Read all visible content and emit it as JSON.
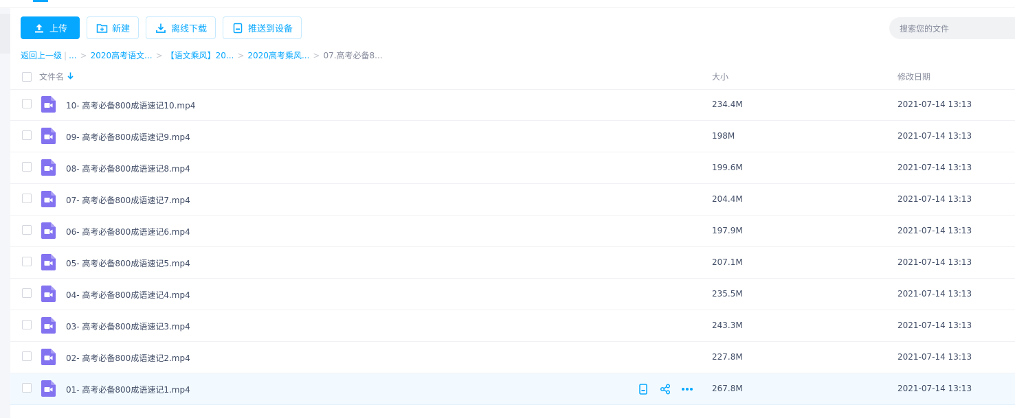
{
  "toolbar": {
    "upload_label": "上传",
    "new_label": "新建",
    "offline_download_label": "离线下载",
    "push_device_label": "推送到设备"
  },
  "search": {
    "placeholder": "搜索您的文件"
  },
  "breadcrumb": {
    "back": "返回上一级",
    "ellipsis": "...",
    "items": [
      "2020高考语文...",
      "【语文乘风】20...",
      "2020高考乘风...",
      "07.高考必备8..."
    ]
  },
  "table": {
    "headers": {
      "name": "文件名",
      "size": "大小",
      "date": "修改日期"
    },
    "rows": [
      {
        "name": "10- 高考必备800成语速记10.mp4",
        "size": "234.4M",
        "date": "2021-07-14 13:13"
      },
      {
        "name": "09- 高考必备800成语速记9.mp4",
        "size": "198M",
        "date": "2021-07-14 13:13"
      },
      {
        "name": "08- 高考必备800成语速记8.mp4",
        "size": "199.6M",
        "date": "2021-07-14 13:13"
      },
      {
        "name": "07- 高考必备800成语速记7.mp4",
        "size": "204.4M",
        "date": "2021-07-14 13:13"
      },
      {
        "name": "06- 高考必备800成语速记6.mp4",
        "size": "197.9M",
        "date": "2021-07-14 13:13"
      },
      {
        "name": "05- 高考必备800成语速记5.mp4",
        "size": "207.1M",
        "date": "2021-07-14 13:13"
      },
      {
        "name": "04- 高考必备800成语速记4.mp4",
        "size": "235.5M",
        "date": "2021-07-14 13:13"
      },
      {
        "name": "03- 高考必备800成语速记3.mp4",
        "size": "243.3M",
        "date": "2021-07-14 13:13"
      },
      {
        "name": "02- 高考必备800成语速记2.mp4",
        "size": "227.8M",
        "date": "2021-07-14 13:13"
      },
      {
        "name": "01- 高考必备800成语速记1.mp4",
        "size": "267.8M",
        "date": "2021-07-14 13:13"
      }
    ]
  },
  "icons": {
    "file_type": "video-file-icon",
    "row_actions": [
      "send-to-device-icon",
      "share-icon",
      "more-icon"
    ]
  },
  "colors": {
    "accent": "#06a7ff",
    "video_icon": "#8373f0",
    "hover_row": "#f2faff"
  }
}
